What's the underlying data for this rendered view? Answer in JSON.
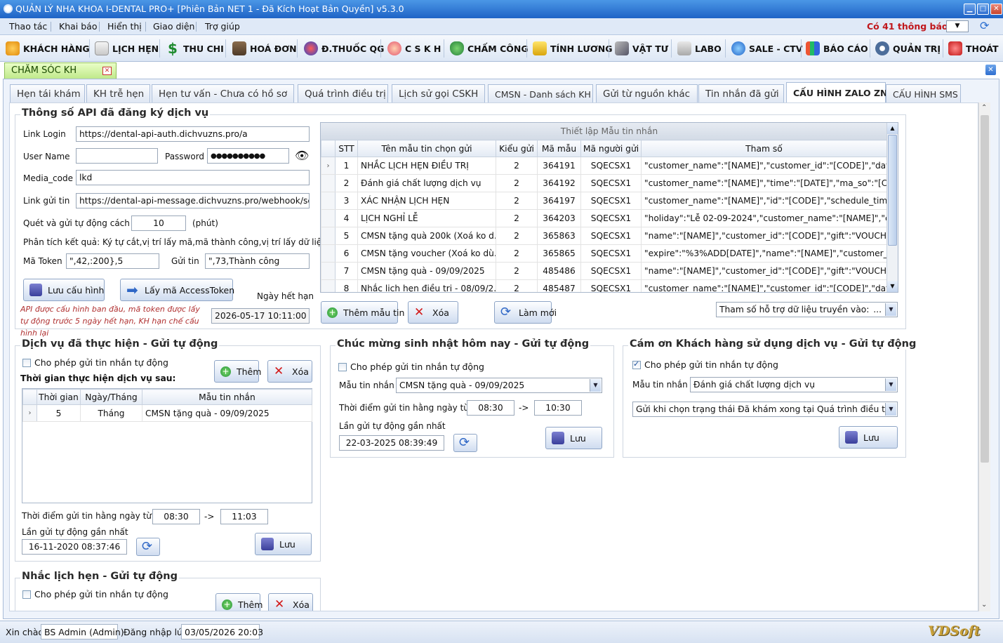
{
  "window": {
    "title": "QUẢN LÝ NHA KHOA I-DENTAL PRO+ [Phiên Bản NET 1 - Đã Kích Hoạt Bản Quyền] v5.3.0"
  },
  "menu": {
    "items": [
      "Thao tác",
      "Khai báo",
      "Hiển thị",
      "Giao diện",
      "Trợ giúp"
    ],
    "notifications": "Có 41 thông báo"
  },
  "toolbar": {
    "items": [
      "KHÁCH HÀNG",
      "LỊCH HẸN",
      "THU CHI",
      "HOÁ ĐƠN",
      "Đ.THUỐC QG",
      "C S K H",
      "CHẤM CÔNG",
      "TÍNH LƯƠNG",
      "VẬT TƯ",
      "LABO",
      "SALE - CTV",
      "BÁO CÁO",
      "QUẢN TRỊ",
      "THOÁT"
    ]
  },
  "doc_tab": {
    "label": "CHĂM SÓC KH"
  },
  "tabs": [
    "Hẹn tái khám",
    "KH trễ hẹn",
    "Hẹn tư vấn - Chưa có hồ sơ",
    "Quá trình điều trị",
    "Lịch sử gọi CSKH",
    "CMSN - Danh sách KH",
    "Gửi từ nguồn khác",
    "Tin nhắn đã gửi",
    "CẤU HÌNH ZALO ZNS",
    "CẤU HÌNH SMS"
  ],
  "api": {
    "title": "Thông số API đã đăng ký dịch vụ",
    "link_login_label": "Link Login",
    "link_login": "https://dental-api-auth.dichvuzns.pro/a",
    "username_label": "User Name",
    "username": "",
    "password_label": "Password",
    "password": "●●●●●●●●●●",
    "media_label": "Media_code",
    "media": "lkd",
    "send_label": "Link gửi tin",
    "send": "https://dental-api-message.dichvuzns.pro/webhook/send",
    "scan_label": "Quét và gửi tự động cách",
    "scan_value": "10",
    "scan_unit": "(phút)",
    "parse_label": "Phân tích kết quả: Ký tự cắt,vị trí lấy mã,mã thành công,vị trí lấy dữ liệu",
    "token_label": "Mã Token",
    "token": "\",42,:200},5",
    "send_result_label": "Gửi tin",
    "send_result": "\",73,Thành công",
    "save_btn": "Lưu cấu hình",
    "token_btn": "Lấy mã AccessToken",
    "expire_label": "Ngày hết hạn",
    "expire": "2026-05-17 10:11:00",
    "note": "API được cấu hình ban đầu, mã token được lấy tự động trước 5 ngày hết hạn, KH hạn chế cấu hình lại"
  },
  "templates": {
    "title": "Thiết lập Mẫu tin nhắn",
    "headers": [
      "STT",
      "Tên mẫu tin chọn gửi",
      "Kiểu gửi",
      "Mã mẫu",
      "Mã người gửi",
      "Tham số"
    ],
    "rows": [
      [
        "1",
        "NHẮC LỊCH HẸN ĐIỀU TRỊ",
        "2",
        "364191",
        "SQECSX1",
        "\"customer_name\":\"[NAME]\",\"customer_id\":\"[CODE]\",\"date..."
      ],
      [
        "2",
        "Đánh giá chất lượng dịch vụ",
        "2",
        "364192",
        "SQECSX1",
        "\"customer_name\":\"[NAME]\",\"time\":\"[DATE]\",\"ma_so\":\"[CO..."
      ],
      [
        "3",
        "XÁC NHẬN LỊCH HẸN",
        "2",
        "364197",
        "SQECSX1",
        "\"customer_name\":\"[NAME]\",\"id\":\"[CODE]\",\"schedule_time\"..."
      ],
      [
        "4",
        "LỊCH NGHỈ LỄ",
        "2",
        "364203",
        "SQECSX1",
        "\"holiday\":\"Lễ 02-09-2024\",\"customer_name\":\"[NAME]\",\"cus..."
      ],
      [
        "5",
        "CMSN tặng quà 200k (Xoá ko d...",
        "2",
        "365863",
        "SQECSX1",
        "\"name\":\"[NAME]\",\"customer_id\":\"[CODE]\",\"gift\":\"VOUCHE..."
      ],
      [
        "6",
        "CMSN tặng voucher (Xoá ko dù...",
        "2",
        "365865",
        "SQECSX1",
        "\"expire\":\"%3%ADD[DATE]\",\"name\":\"[NAME]\",\"customer_i..."
      ],
      [
        "7",
        "CMSN tặng quà - 09/09/2025",
        "2",
        "485486",
        "SQECSX1",
        "\"name\":\"[NAME]\",\"customer_id\":\"[CODE]\",\"gift\":\"VOUCHE..."
      ],
      [
        "8",
        "Nhắc lịch hẹn điều trị - 08/09/2...",
        "2",
        "485487",
        "SQECSX1",
        "\"customer_name\":\"[NAME]\",\"customer_id\":\"[CODE]\",\"date..."
      ]
    ],
    "add_btn": "Thêm mẫu tin",
    "del_btn": "Xóa",
    "refresh_btn": "Làm mới",
    "param_dd": "Tham số hỗ trợ dữ liệu truyền vào:",
    "param_dd_suffix": "..."
  },
  "service": {
    "title": "Dịch vụ đã thực hiện - Gửi tự động",
    "allow": "Cho phép gửi tin nhắn tự động",
    "add": "Thêm",
    "del": "Xóa",
    "after_label": "Thời gian thực hiện dịch vụ sau:",
    "headers": [
      "Thời gian",
      "Ngày/Tháng",
      "Mẫu tin nhắn"
    ],
    "rows": [
      [
        "5",
        "Tháng",
        "CMSN tặng quà - 09/09/2025"
      ]
    ],
    "time_label": "Thời điểm gửi tin hằng ngày từ",
    "from": "08:30",
    "arrow": "->",
    "to": "11:03",
    "last_label": "Lần gửi tự động gần nhất",
    "last": "16-11-2020 08:37:46",
    "save": "Lưu"
  },
  "birthday": {
    "title": "Chúc mừng sinh nhật hôm nay - Gửi tự động",
    "allow": "Cho phép gửi tin nhắn tự động",
    "tpl_label": "Mẫu tin nhắn",
    "tpl": "CMSN tặng quà - 09/09/2025",
    "time_label": "Thời điểm gửi tin hằng ngày từ",
    "from": "08:30",
    "arrow": "->",
    "to": "10:30",
    "last_label": "Lần gửi tự động gần nhất",
    "last": "22-03-2025 08:39:49",
    "save": "Lưu"
  },
  "thanks": {
    "title": "Cám ơn Khách hàng sử dụng dịch vụ - Gửi tự động",
    "allow": "Cho phép gửi tin nhắn tự động",
    "tpl_label": "Mẫu tin nhắn",
    "tpl": "Đánh giá chất lượng dịch vụ",
    "trigger": "Gửi khi chọn trạng thái Đã khám xong tại Quá trình điều trị",
    "save": "Lưu"
  },
  "reminder": {
    "title": "Nhắc lịch hẹn - Gửi tự động",
    "allow": "Cho phép gửi tin nhắn tự động",
    "add": "Thêm",
    "del": "Xóa"
  },
  "status": {
    "hello": "Xin chào",
    "user": "BS Admin (Admin)",
    "login_label": "Đăng nhập lúc",
    "login": "03/05/2026 20:03",
    "brand": "VDSoft"
  }
}
